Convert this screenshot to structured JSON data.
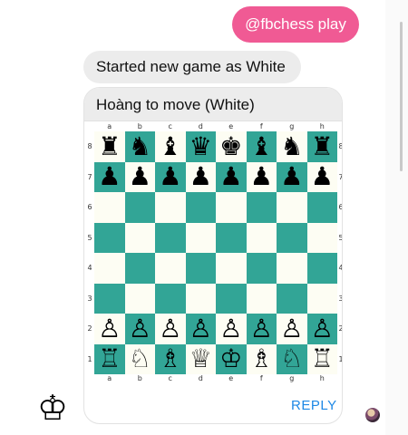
{
  "messages": {
    "outgoing": "@fbchess play",
    "incoming": "Started new game as White"
  },
  "card": {
    "title": "Hoàng to move (White)",
    "reply_label": "REPLY"
  },
  "chess": {
    "files": [
      "a",
      "b",
      "c",
      "d",
      "e",
      "f",
      "g",
      "h"
    ],
    "ranks": [
      "8",
      "7",
      "6",
      "5",
      "4",
      "3",
      "2",
      "1"
    ],
    "light_square_color": "#fdfdf3",
    "dark_square_color": "#32a596",
    "position": [
      [
        "♜",
        "♞",
        "♝",
        "♛",
        "♚",
        "♝",
        "♞",
        "♜"
      ],
      [
        "♟",
        "♟",
        "♟",
        "♟",
        "♟",
        "♟",
        "♟",
        "♟"
      ],
      [
        "",
        "",
        "",
        "",
        "",
        "",
        "",
        ""
      ],
      [
        "",
        "",
        "",
        "",
        "",
        "",
        "",
        ""
      ],
      [
        "",
        "",
        "",
        "",
        "",
        "",
        "",
        ""
      ],
      [
        "",
        "",
        "",
        "",
        "",
        "",
        "",
        ""
      ],
      [
        "♙",
        "♙",
        "♙",
        "♙",
        "♙",
        "♙",
        "♙",
        "♙"
      ],
      [
        "♖",
        "♘",
        "♗",
        "♕",
        "♔",
        "♗",
        "♘",
        "♖"
      ]
    ]
  },
  "avatars": {
    "bot": "♔",
    "bot_icon": "king-icon",
    "user_icon": "user-avatar"
  },
  "colors": {
    "outgoing_bubble": "#f05a94",
    "incoming_bubble": "#ececec",
    "reply_text": "#1e88e5"
  }
}
